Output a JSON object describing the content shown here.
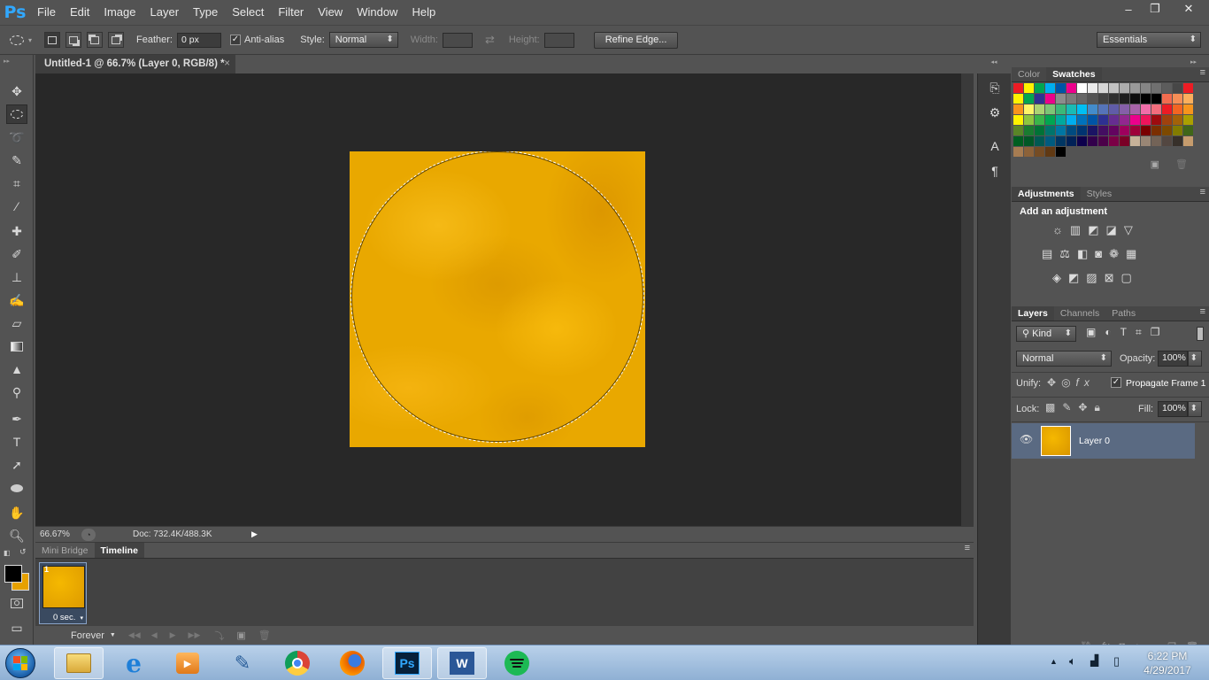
{
  "app": {
    "logo": "Ps"
  },
  "menu": [
    "File",
    "Edit",
    "Image",
    "Layer",
    "Type",
    "Select",
    "Filter",
    "View",
    "Window",
    "Help"
  ],
  "window_controls": {
    "minimize": "–",
    "restore": "❐",
    "close": "✕"
  },
  "options": {
    "feather_label": "Feather:",
    "feather_value": "0 px",
    "antialias_label": "Anti-alias",
    "antialias_checked": true,
    "style_label": "Style:",
    "style_value": "Normal",
    "width_label": "Width:",
    "height_label": "Height:",
    "refine_edge": "Refine Edge...",
    "workspace": "Essentials"
  },
  "document": {
    "tab_title": "Untitled-1 @ 66.7% (Layer 0, RGB/8) *",
    "close": "×",
    "zoom": "66.67%",
    "doc_info": "Doc: 732.4K/488.3K",
    "canvas_color": "#f0b000"
  },
  "timeline": {
    "tabs": [
      "Mini Bridge",
      "Timeline"
    ],
    "active_tab": "Timeline",
    "frame_number": "1",
    "frame_delay": "0 sec.",
    "loop": "Forever"
  },
  "swatches_panel": {
    "tabs": [
      "Color",
      "Swatches"
    ],
    "active_tab": "Swatches",
    "colors": [
      "#ed1c24",
      "#fff200",
      "#00a651",
      "#00aeef",
      "#0054a6",
      "#ec008c",
      "#ffffff",
      "#ebebeb",
      "#d6d6d6",
      "#c2c2c2",
      "#adadad",
      "#999999",
      "#858585",
      "#707070",
      "#5c5c5c",
      "#474747",
      "#ed1c24",
      "#fff200",
      "#00a651",
      "#2e3192",
      "#ec008c",
      "#8c8c8c",
      "#7a7a7a",
      "#666666",
      "#545454",
      "#424242",
      "#303030",
      "#1f1f1f",
      "#0d0d0d",
      "#000000",
      "#000000",
      "#f26c4f",
      "#f68e56",
      "#fbaf5d",
      "#f7941d",
      "#fff568",
      "#acd373",
      "#7cc576",
      "#3bb878",
      "#1abbb4",
      "#00bff3",
      "#438ccb",
      "#5574b9",
      "#605ca8",
      "#855fa8",
      "#a763a8",
      "#f06ea9",
      "#f26d7d",
      "#ed1c24",
      "#f26522",
      "#f7941d",
      "#fff200",
      "#8dc63f",
      "#39b54a",
      "#00a651",
      "#00a99d",
      "#00aeef",
      "#0072bc",
      "#0054a6",
      "#2e3192",
      "#662d91",
      "#92278f",
      "#ec008c",
      "#ed145b",
      "#9e0b0f",
      "#a0410d",
      "#a36209",
      "#aba000",
      "#598527",
      "#197b30",
      "#007236",
      "#00746b",
      "#0076a3",
      "#004b80",
      "#003471",
      "#1b1464",
      "#440e62",
      "#630460",
      "#9e005d",
      "#9e0039",
      "#790000",
      "#7b2e00",
      "#7d4900",
      "#827b00",
      "#406618",
      "#005e20",
      "#005826",
      "#005952",
      "#005b7f",
      "#003663",
      "#002157",
      "#0d004c",
      "#32004b",
      "#4b0049",
      "#7b0046",
      "#7a0026",
      "#c7b299",
      "#998675",
      "#736357",
      "#534741",
      "#37302a",
      "#c69c6d",
      "#a67c52",
      "#8c6239",
      "#754c24",
      "#603913",
      "#000000"
    ]
  },
  "adjustments_panel": {
    "tabs": [
      "Adjustments",
      "Styles"
    ],
    "active_tab": "Adjustments",
    "heading": "Add an adjustment"
  },
  "layers_panel": {
    "tabs": [
      "Layers",
      "Channels",
      "Paths"
    ],
    "active_tab": "Layers",
    "filter_kind": "Kind",
    "blend_mode": "Normal",
    "opacity_label": "Opacity:",
    "opacity_value": "100%",
    "unify_label": "Unify:",
    "propagate_label": "Propagate Frame 1",
    "lock_label": "Lock:",
    "fill_label": "Fill:",
    "fill_value": "100%",
    "layer_name": "Layer 0"
  },
  "taskbar": {
    "time": "6:22 PM",
    "date": "4/29/2017"
  }
}
